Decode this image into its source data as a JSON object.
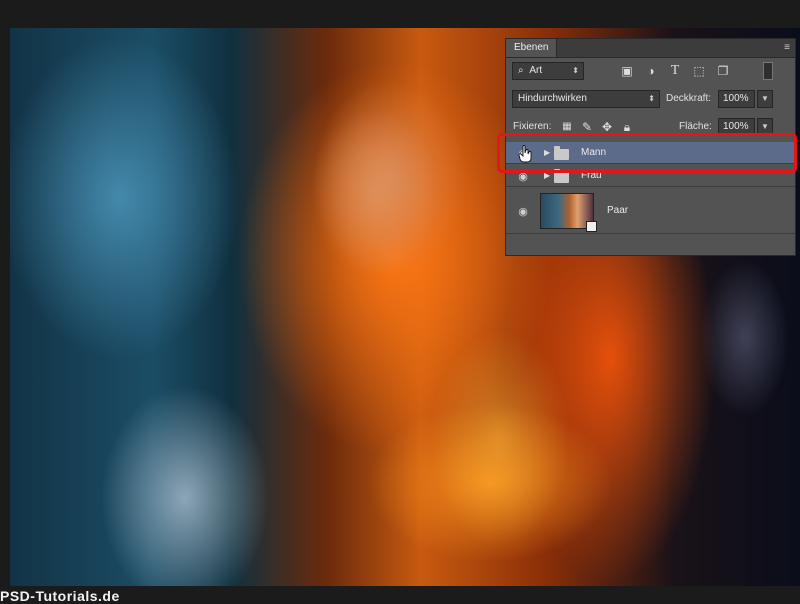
{
  "panel": {
    "title": "Ebenen",
    "menu_icon": "panel-menu-icon",
    "filter": {
      "label": "Art"
    },
    "blend_mode": "Hindurchwirken",
    "opacity_label": "Deckkraft:",
    "opacity_value": "100%",
    "lock_label": "Fixieren:",
    "fill_label": "Fläche:",
    "fill_value": "100%"
  },
  "layers": [
    {
      "name": "Mann",
      "type": "group",
      "visible": true,
      "selected": true
    },
    {
      "name": "Frau",
      "type": "group",
      "visible": true,
      "selected": false
    },
    {
      "name": "Paar",
      "type": "smart-object",
      "visible": true,
      "selected": false
    }
  ],
  "colors": {
    "highlight": "#e8141b",
    "panel_bg": "#535353",
    "selected_row": "#5d6b8a"
  },
  "caption": "PSD-Tutorials.de"
}
